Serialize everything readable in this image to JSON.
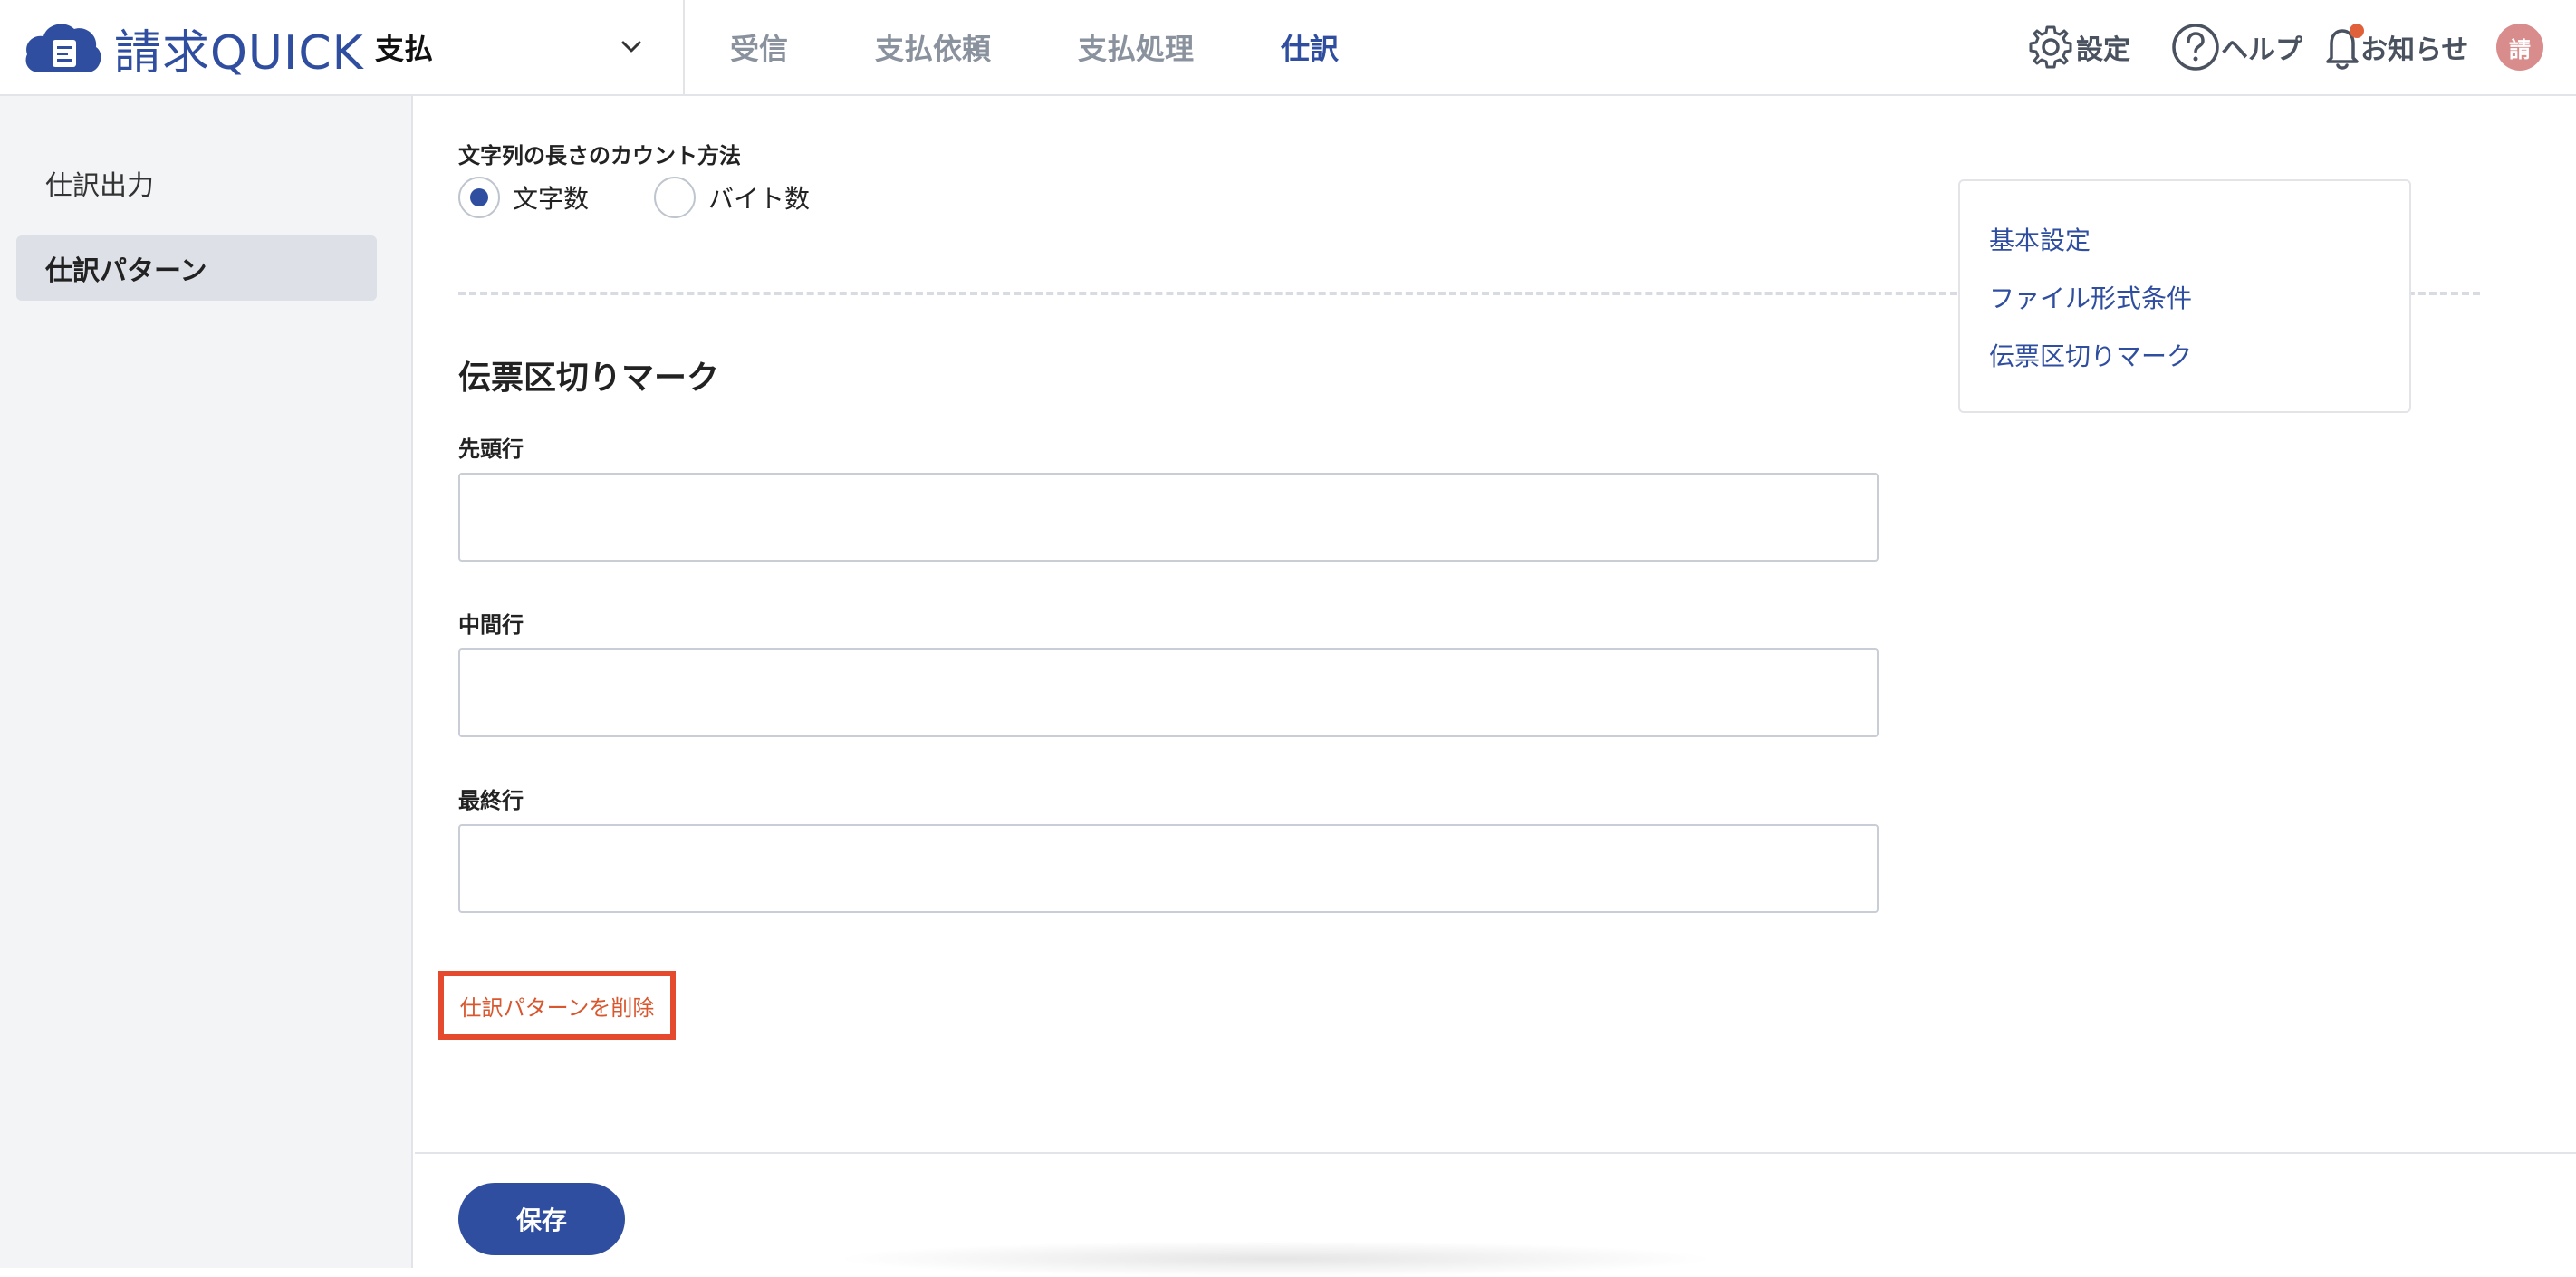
{
  "app": {
    "brand": "請求QUICK",
    "module": "支払"
  },
  "nav": {
    "tabs": [
      "受信",
      "支払依頼",
      "支払処理",
      "仕訳"
    ],
    "active": "仕訳"
  },
  "utilities": {
    "settings": "設定",
    "help": "ヘルプ",
    "notifications": "お知らせ",
    "avatar_initial": "請"
  },
  "sidebar": {
    "items": [
      {
        "label": "仕訳出力",
        "active": false
      },
      {
        "label": "仕訳パターン",
        "active": true
      }
    ]
  },
  "form": {
    "count_method": {
      "label": "文字列の長さのカウント方法",
      "options": [
        {
          "label": "文字数",
          "checked": true
        },
        {
          "label": "バイト数",
          "checked": false
        }
      ]
    },
    "delimiter_section": {
      "title": "伝票区切りマーク",
      "fields": [
        {
          "label": "先頭行",
          "value": "",
          "placeholder": ""
        },
        {
          "label": "中間行",
          "value": "",
          "placeholder": ""
        },
        {
          "label": "最終行",
          "value": "",
          "placeholder": ""
        }
      ]
    },
    "delete_link": "仕訳パターンを削除"
  },
  "toc": {
    "items": [
      "基本設定",
      "ファイル形式条件",
      "伝票区切りマーク"
    ]
  },
  "footer": {
    "save_label": "保存"
  },
  "colors": {
    "brand": "#2f4ea0",
    "danger": "#d8572f",
    "highlight_border": "#e64a2e",
    "notification": "#e0603a"
  }
}
